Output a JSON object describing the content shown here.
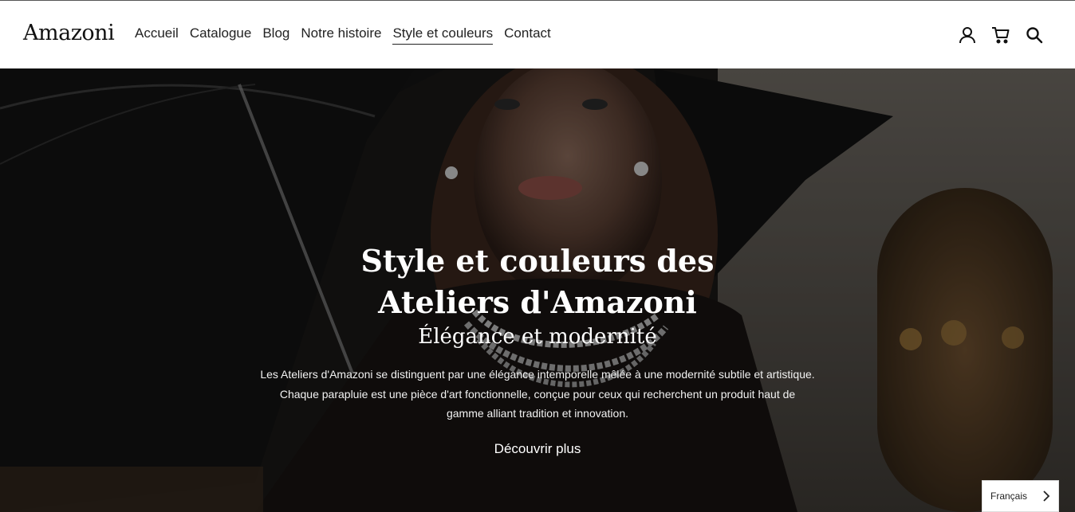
{
  "header": {
    "logo": "Amazoni",
    "nav": [
      {
        "label": "Accueil"
      },
      {
        "label": "Catalogue"
      },
      {
        "label": "Blog"
      },
      {
        "label": "Notre histoire"
      },
      {
        "label": "Style et couleurs",
        "active": true
      },
      {
        "label": "Contact"
      }
    ],
    "icons": [
      "account-icon",
      "cart-icon",
      "search-icon"
    ]
  },
  "hero": {
    "title_line1": "Style et couleurs des",
    "title_line2": "Ateliers d'Amazoni",
    "subtitle": "Élégance et modernité",
    "desc_line1": "Les Ateliers d'Amazoni se distinguent par une élégance intemporelle mêlée à une modernité subtile et artistique.",
    "desc_line2": "Chaque parapluie est une pièce d'art fonctionnelle, conçue pour ceux qui recherchent un produit haut de",
    "desc_line3": "gamme alliant tradition et innovation.",
    "cta": "Découvrir plus"
  },
  "language_selector": {
    "value": "Français",
    "icon": "chevron-right-icon"
  },
  "colors": {
    "text_dark": "#111111",
    "hero_overlay": "#1a1816",
    "white": "#ffffff"
  }
}
